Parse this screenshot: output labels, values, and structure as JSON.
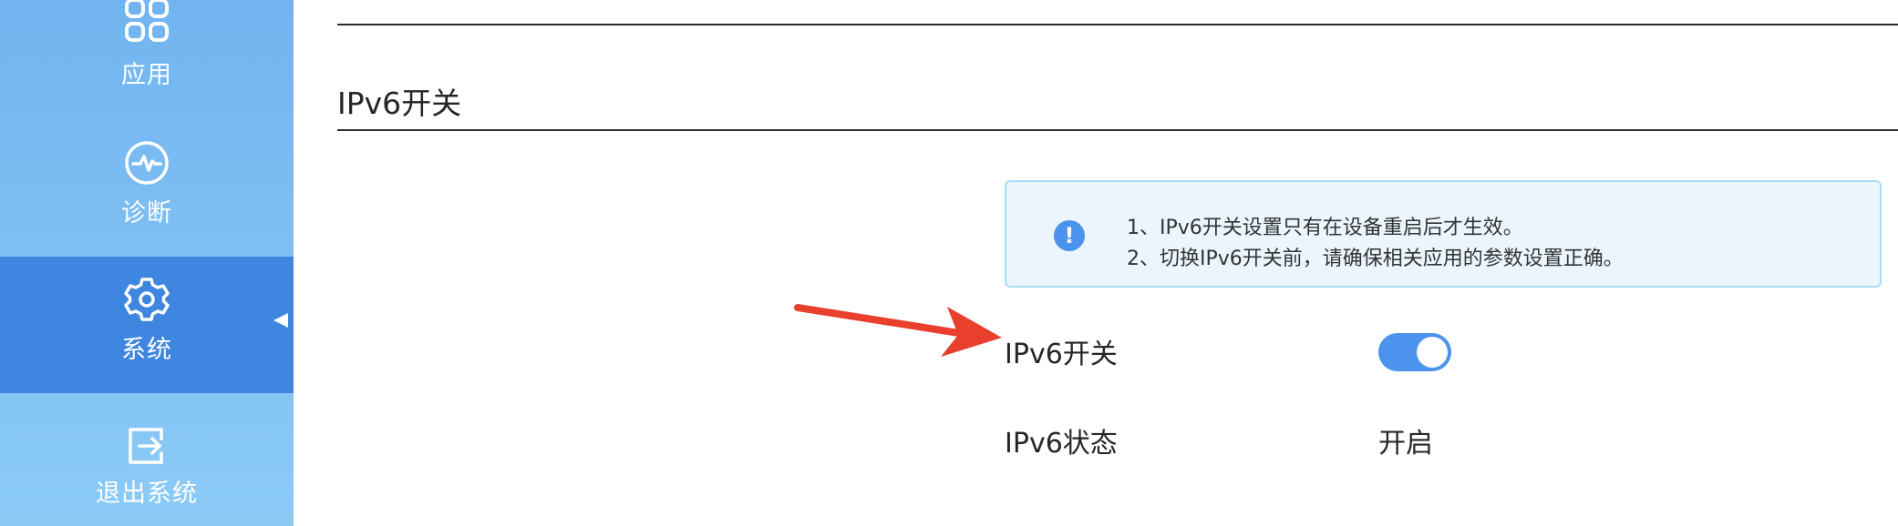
{
  "sidebar": {
    "items": [
      {
        "label": "应用",
        "icon": "grid-icon"
      },
      {
        "label": "诊断",
        "icon": "pulse-icon"
      },
      {
        "label": "系统",
        "icon": "gear-icon",
        "active": true
      },
      {
        "label": "退出系统",
        "icon": "exit-icon"
      }
    ]
  },
  "main": {
    "section_title": "IPv6开关",
    "notice": {
      "icon": "exclamation-icon",
      "lines": [
        "1、IPv6开关设置只有在设备重启后才生效。",
        "2、切换IPv6开关前，请确保相关应用的参数设置正确。"
      ]
    },
    "fields": {
      "switch_label": "IPv6开关",
      "switch_on": true,
      "status_label": "IPv6状态",
      "status_value": "开启"
    }
  },
  "colors": {
    "sidebar_gradient_top": "#71b4f0",
    "sidebar_gradient_bottom": "#8ccbf6",
    "sidebar_active": "#3e86e0",
    "accent_blue": "#4b93ec",
    "notice_bg": "#eaf5fd",
    "notice_border": "#a9dcf6",
    "arrow_red": "#e8402d"
  }
}
